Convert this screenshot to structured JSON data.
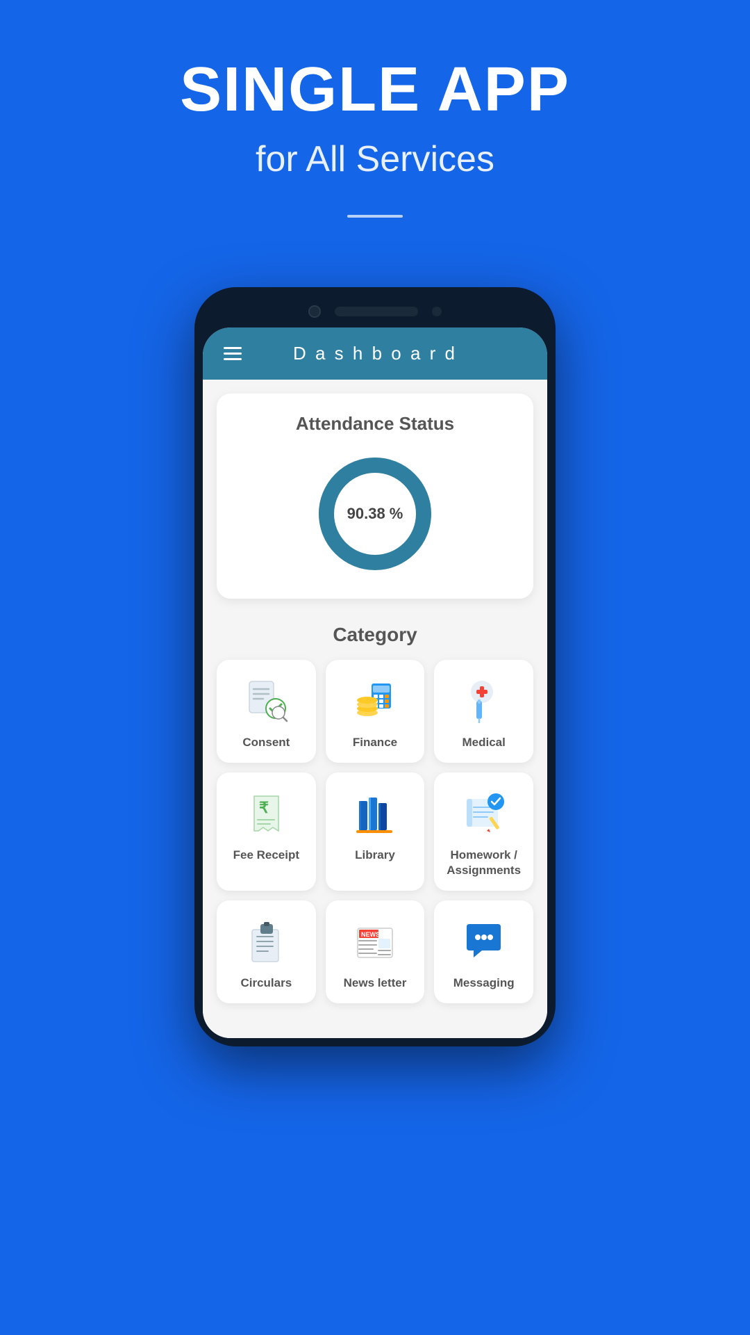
{
  "hero": {
    "title": "SINGLE APP",
    "subtitle": "for All Services"
  },
  "app": {
    "header_title": "D a s h b o a r d"
  },
  "attendance": {
    "title": "Attendance Status",
    "percentage": "90.38 %",
    "value": 90.38
  },
  "category": {
    "title": "Category",
    "items": [
      {
        "id": "consent",
        "label": "Consent",
        "icon": "consent"
      },
      {
        "id": "finance",
        "label": "Finance",
        "icon": "finance"
      },
      {
        "id": "medical",
        "label": "Medical",
        "icon": "medical"
      },
      {
        "id": "fee-receipt",
        "label": "Fee Receipt",
        "icon": "fee-receipt"
      },
      {
        "id": "library",
        "label": "Library",
        "icon": "library"
      },
      {
        "id": "homework",
        "label": "Homework /\nAssignments",
        "icon": "homework"
      },
      {
        "id": "circulars",
        "label": "Circulars",
        "icon": "circulars"
      },
      {
        "id": "newsletter",
        "label": "News letter",
        "icon": "newsletter"
      },
      {
        "id": "messaging",
        "label": "Messaging",
        "icon": "messaging"
      }
    ]
  },
  "colors": {
    "blue": "#1565e8",
    "teal": "#2e7fa0",
    "green": "#4caf50",
    "orange": "#ff9800",
    "red": "#f44336"
  }
}
